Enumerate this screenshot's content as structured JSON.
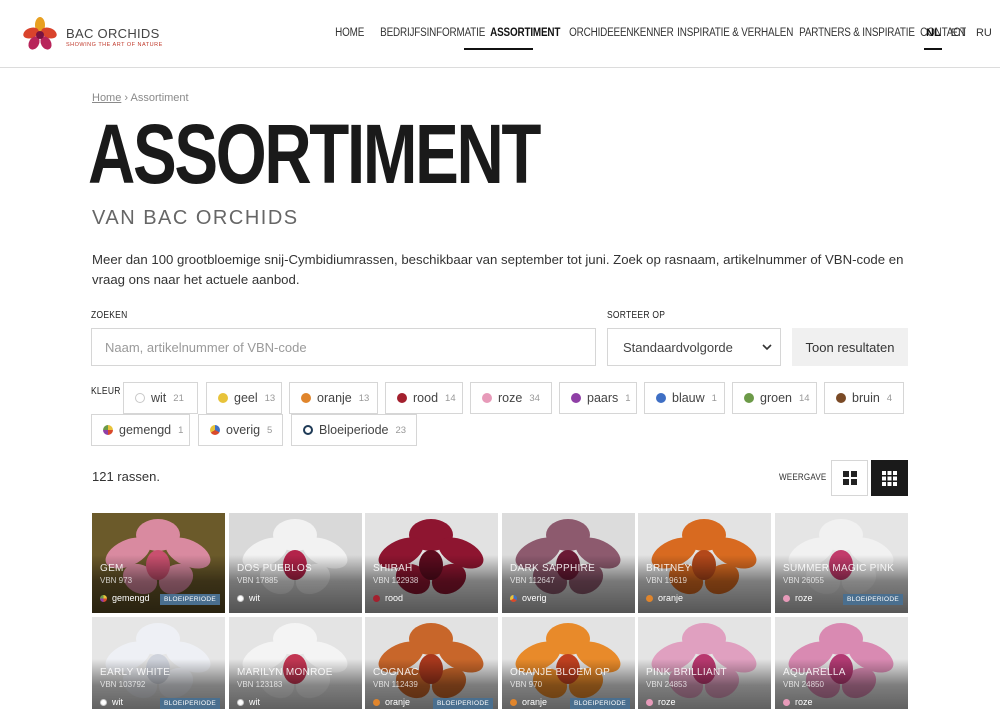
{
  "brand": {
    "name": "BAC ORCHIDS",
    "tagline": "SHOWING THE ART OF NATURE"
  },
  "nav": {
    "items": [
      "HOME",
      "BEDRIJFSINFORMATIE",
      "ASSORTIMENT",
      "ORCHIDEEËNKENNER",
      "INSPIRATIE & VERHALEN",
      "PARTNERS & INSPIRATIE",
      "CONTACT"
    ],
    "active": "ASSORTIMENT"
  },
  "languages": {
    "items": [
      "NL",
      "EN",
      "RU"
    ],
    "active": "NL"
  },
  "breadcrumb": {
    "home": "Home",
    "separator": "›",
    "current": "Assortiment"
  },
  "page": {
    "title": "ASSORTIMENT",
    "subtitle": "VAN BAC ORCHIDS",
    "intro": "Meer dan 100 grootbloemige snij-Cymbidiumrassen, beschikbaar van september tot juni. Zoek op rasnaam, artikelnummer of VBN-code en vraag ons naar het actuele aanbod."
  },
  "search": {
    "label": "ZOEKEN",
    "placeholder": "Naam, artikelnummer of VBN-code",
    "value": ""
  },
  "sort": {
    "label": "SORTEER OP",
    "selected": "Standaardvolgorde"
  },
  "show_button": "Toon resultaten",
  "filters": {
    "label": "KLEUR",
    "chips": [
      {
        "label": "wit",
        "count": "21",
        "color": "#ffffff"
      },
      {
        "label": "geel",
        "count": "13",
        "color": "#e8c33a"
      },
      {
        "label": "oranje",
        "count": "13",
        "color": "#e0852c"
      },
      {
        "label": "rood",
        "count": "14",
        "color": "#a3202e"
      },
      {
        "label": "roze",
        "count": "34",
        "color": "#e79ab9"
      },
      {
        "label": "paars",
        "count": "1",
        "color": "#8f3fa6"
      },
      {
        "label": "blauw",
        "count": "1",
        "color": "#3f6fc4"
      },
      {
        "label": "groen",
        "count": "14",
        "color": "#6c9a48"
      },
      {
        "label": "bruin",
        "count": "4",
        "color": "#7a4a26"
      },
      {
        "label": "gemengd",
        "count": "1",
        "color": "multi"
      },
      {
        "label": "overig",
        "count": "5",
        "color": "multi2"
      },
      {
        "label": "Bloeiperiode",
        "count": "23",
        "color": "ring"
      }
    ]
  },
  "results": {
    "count_text": "121 rassen.",
    "view_label": "WEERGAVE"
  },
  "products": [
    {
      "name": "GEM",
      "vbn": "VBN 973",
      "color": "gemengd",
      "dot": "multi",
      "badge": "BLOEIPERIODE",
      "petal": "#d98aa0",
      "lip": "#c9506f",
      "bg": "#6b5a2a"
    },
    {
      "name": "DOS PUEBLOS",
      "vbn": "VBN 17885",
      "color": "wit",
      "dot": "#ffffff",
      "badge": "",
      "petal": "#f2f2f2",
      "lip": "#b3234a",
      "bg": "#d9d9d9"
    },
    {
      "name": "SHIRAH",
      "vbn": "VBN 122938",
      "color": "rood",
      "dot": "#a3202e",
      "badge": "",
      "petal": "#8e1530",
      "lip": "#5c0b1e",
      "bg": "#e2e2e2"
    },
    {
      "name": "DARK SAPPHIRE",
      "vbn": "VBN 112647",
      "color": "overig",
      "dot": "multi2",
      "badge": "",
      "petal": "#8d5a6e",
      "lip": "#6a1a35",
      "bg": "#dcdcdc"
    },
    {
      "name": "BRITNEY",
      "vbn": "VBN 19619",
      "color": "oranje",
      "dot": "#e0852c",
      "badge": "",
      "petal": "#d86a20",
      "lip": "#b3481a",
      "bg": "#e3e3e3"
    },
    {
      "name": "SUMMER MAGIC PINK",
      "vbn": "VBN 26055",
      "color": "roze",
      "dot": "#e79ab9",
      "badge": "BLOEIPERIODE",
      "petal": "#f1f1f1",
      "lip": "#c23a6b",
      "bg": "#e5e5e5"
    },
    {
      "name": "EARLY WHITE",
      "vbn": "VBN 103792",
      "color": "wit",
      "dot": "#ffffff",
      "badge": "BLOEIPERIODE",
      "petal": "#eef0f5",
      "lip": "#cfd3dc",
      "bg": "#e6e6e6"
    },
    {
      "name": "MARILYN MONROE",
      "vbn": "VBN 123183",
      "color": "wit",
      "dot": "#ffffff",
      "badge": "",
      "petal": "#f4f4f4",
      "lip": "#c23552",
      "bg": "#e4e4e4"
    },
    {
      "name": "COGNAC",
      "vbn": "VBN 112439",
      "color": "oranje",
      "dot": "#e0852c",
      "badge": "BLOEIPERIODE",
      "petal": "#c8662a",
      "lip": "#a8381d",
      "bg": "#e2e2e2"
    },
    {
      "name": "ORANJE BLOEM OP",
      "vbn": "VBN 970",
      "color": "oranje",
      "dot": "#e0852c",
      "badge": "BLOEIPERIODE",
      "petal": "#e88a2a",
      "lip": "#c0401f",
      "bg": "#e3e3e3"
    },
    {
      "name": "PINK BRILLIANT",
      "vbn": "VBN 24853",
      "color": "roze",
      "dot": "#e79ab9",
      "badge": "",
      "petal": "#e0a0c0",
      "lip": "#b8386e",
      "bg": "#e4e4e4"
    },
    {
      "name": "AQUARELLA",
      "vbn": "VBN 24850",
      "color": "roze",
      "dot": "#e79ab9",
      "badge": "",
      "petal": "#d98ab2",
      "lip": "#b23a73",
      "bg": "#e5e5e5"
    }
  ]
}
